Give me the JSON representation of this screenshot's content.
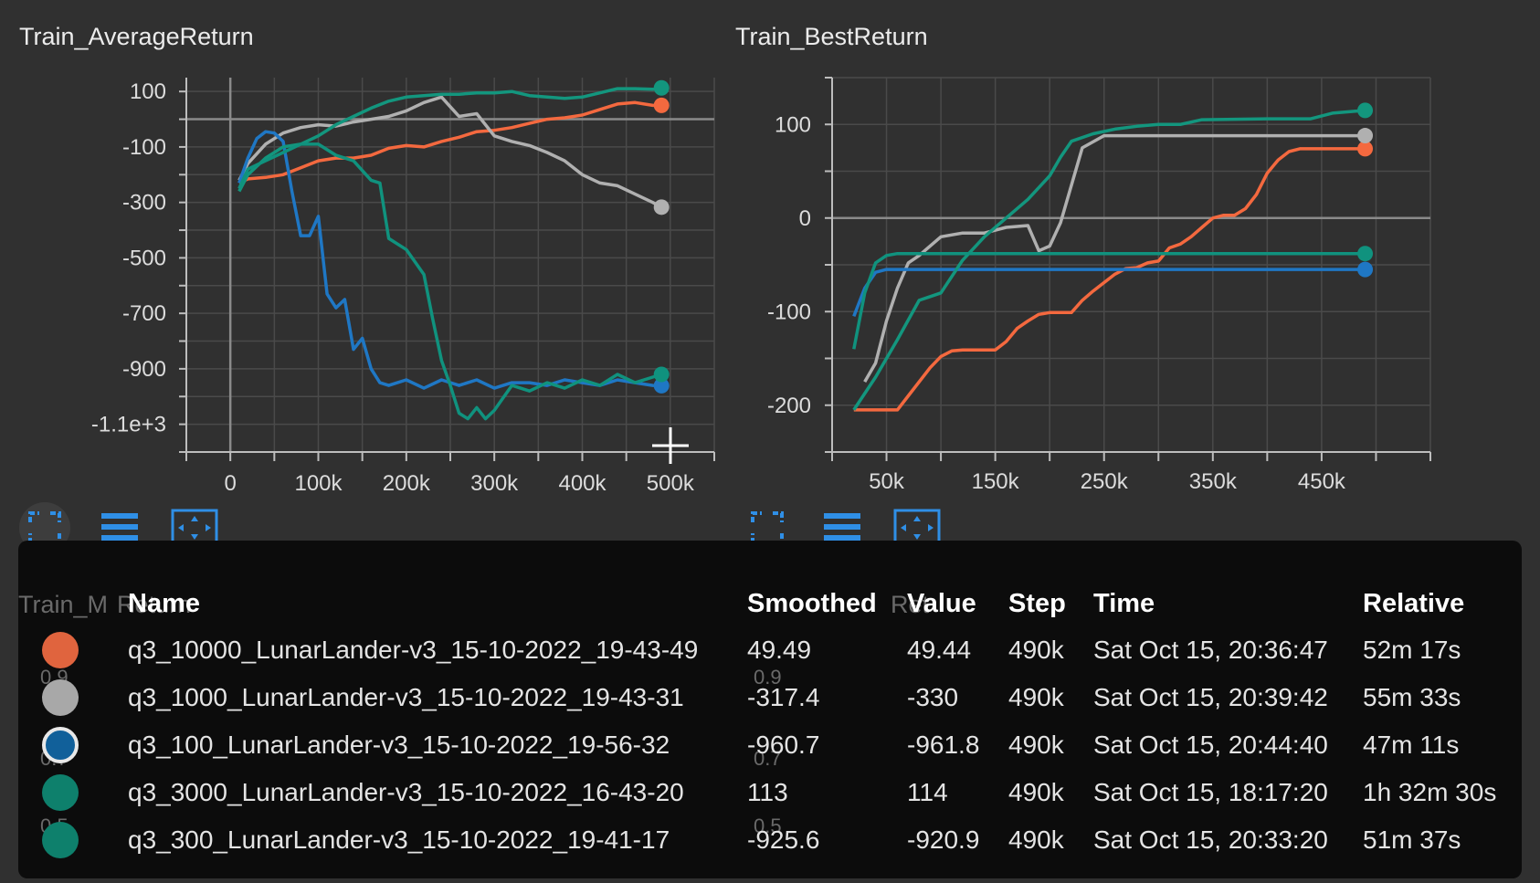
{
  "charts": {
    "left": {
      "title": "Train_AverageReturn"
    },
    "right": {
      "title": "Train_BestReturn"
    },
    "hidden": {
      "title": "Train_MaxReturn",
      "ghost_left": "Train_M",
      "ghost_left_tail": "Return",
      "ghost_right_tail": "Ret"
    }
  },
  "chart_data": [
    {
      "type": "line",
      "title": "Train_AverageReturn",
      "xlabel": "",
      "ylabel": "",
      "xlim": [
        -50000,
        550000
      ],
      "ylim": [
        -1200,
        150
      ],
      "x_ticks": [
        0,
        100000,
        200000,
        300000,
        400000,
        500000
      ],
      "x_tick_labels": [
        "0",
        "100k",
        "200k",
        "300k",
        "400k",
        "500k"
      ],
      "y_ticks": [
        100,
        -100,
        -300,
        -500,
        -700,
        -900,
        -1100
      ],
      "y_tick_labels": [
        "100",
        "-100",
        "-300",
        "-500",
        "-700",
        "-900",
        "-1.1e+3"
      ],
      "grid": true,
      "series": [
        {
          "color": "#f4693f",
          "x": [
            10000,
            20000,
            40000,
            60000,
            80000,
            100000,
            120000,
            140000,
            160000,
            180000,
            200000,
            220000,
            240000,
            260000,
            280000,
            300000,
            320000,
            340000,
            360000,
            380000,
            400000,
            420000,
            440000,
            460000,
            480000,
            490000
          ],
          "y": [
            -230,
            -215,
            -210,
            -200,
            -175,
            -150,
            -140,
            -140,
            -130,
            -105,
            -95,
            -100,
            -80,
            -65,
            -45,
            -40,
            -30,
            -15,
            0,
            5,
            15,
            35,
            55,
            60,
            50,
            50
          ]
        },
        {
          "color": "#b0b0b0",
          "x": [
            10000,
            20000,
            40000,
            60000,
            80000,
            100000,
            120000,
            140000,
            160000,
            180000,
            200000,
            220000,
            240000,
            250000,
            260000,
            280000,
            300000,
            320000,
            340000,
            360000,
            380000,
            400000,
            420000,
            440000,
            460000,
            480000,
            490000
          ],
          "y": [
            -220,
            -160,
            -90,
            -50,
            -30,
            -20,
            -25,
            -10,
            0,
            10,
            30,
            60,
            80,
            45,
            10,
            20,
            -60,
            -80,
            -95,
            -120,
            -150,
            -200,
            -230,
            -240,
            -270,
            -300,
            -317
          ]
        },
        {
          "color": "#1f77c4",
          "x": [
            10000,
            20000,
            30000,
            40000,
            50000,
            60000,
            70000,
            80000,
            90000,
            100000,
            110000,
            120000,
            130000,
            140000,
            150000,
            160000,
            170000,
            180000,
            200000,
            220000,
            240000,
            260000,
            280000,
            300000,
            320000,
            340000,
            360000,
            380000,
            400000,
            420000,
            440000,
            460000,
            480000,
            490000
          ],
          "y": [
            -230,
            -140,
            -70,
            -45,
            -50,
            -80,
            -260,
            -420,
            -420,
            -350,
            -630,
            -680,
            -650,
            -830,
            -790,
            -900,
            -950,
            -960,
            -940,
            -970,
            -940,
            -960,
            -940,
            -970,
            -950,
            -950,
            -960,
            -940,
            -950,
            -960,
            -940,
            -950,
            -960,
            -961
          ]
        },
        {
          "color": "#13967e",
          "x": [
            10000,
            20000,
            40000,
            60000,
            80000,
            100000,
            120000,
            140000,
            160000,
            180000,
            200000,
            220000,
            240000,
            260000,
            280000,
            300000,
            320000,
            340000,
            360000,
            380000,
            400000,
            420000,
            440000,
            460000,
            480000,
            490000
          ],
          "y": [
            -260,
            -200,
            -140,
            -100,
            -90,
            -60,
            -20,
            10,
            40,
            65,
            80,
            85,
            90,
            90,
            95,
            95,
            100,
            85,
            80,
            75,
            80,
            95,
            110,
            110,
            108,
            113
          ]
        },
        {
          "color": "#10927e",
          "x": [
            10000,
            20000,
            40000,
            60000,
            80000,
            100000,
            120000,
            140000,
            160000,
            170000,
            180000,
            200000,
            220000,
            230000,
            240000,
            250000,
            260000,
            270000,
            280000,
            290000,
            300000,
            320000,
            340000,
            360000,
            380000,
            400000,
            420000,
            440000,
            460000,
            480000,
            490000
          ],
          "y": [
            -250,
            -180,
            -150,
            -120,
            -90,
            -90,
            -130,
            -150,
            -220,
            -230,
            -430,
            -470,
            -560,
            -720,
            -870,
            -960,
            -1060,
            -1080,
            -1040,
            -1080,
            -1050,
            -960,
            -980,
            -950,
            -970,
            -940,
            -960,
            -920,
            -950,
            -930,
            -920
          ]
        }
      ]
    },
    {
      "type": "line",
      "title": "Train_BestReturn",
      "xlabel": "",
      "ylabel": "",
      "xlim": [
        0,
        550000
      ],
      "ylim": [
        -250,
        150
      ],
      "x_ticks": [
        50000,
        150000,
        250000,
        350000,
        450000
      ],
      "x_tick_labels": [
        "50k",
        "150k",
        "250k",
        "350k",
        "450k"
      ],
      "y_ticks": [
        100,
        0,
        -100,
        -200
      ],
      "y_tick_labels": [
        "100",
        "0",
        "-100",
        "-200"
      ],
      "grid": true,
      "series": [
        {
          "color": "#f4693f",
          "x": [
            20000,
            40000,
            60000,
            70000,
            90000,
            100000,
            110000,
            120000,
            130000,
            140000,
            150000,
            160000,
            170000,
            180000,
            190000,
            200000,
            220000,
            230000,
            240000,
            260000,
            270000,
            280000,
            290000,
            300000,
            310000,
            320000,
            330000,
            340000,
            350000,
            360000,
            370000,
            380000,
            390000,
            400000,
            410000,
            420000,
            430000,
            440000,
            460000,
            490000
          ],
          "y": [
            -205,
            -205,
            -205,
            -190,
            -160,
            -148,
            -142,
            -141,
            -141,
            -141,
            -141,
            -132,
            -118,
            -110,
            -103,
            -101,
            -101,
            -88,
            -78,
            -60,
            -54,
            -53,
            -48,
            -46,
            -32,
            -28,
            -20,
            -10,
            0,
            3,
            3,
            10,
            25,
            48,
            62,
            71,
            74,
            74,
            74,
            74
          ]
        },
        {
          "color": "#b0b0b0",
          "x": [
            30000,
            40000,
            50000,
            60000,
            70000,
            80000,
            100000,
            120000,
            140000,
            160000,
            180000,
            190000,
            200000,
            210000,
            220000,
            230000,
            250000,
            300000,
            400000,
            490000
          ],
          "y": [
            -175,
            -155,
            -110,
            -75,
            -48,
            -40,
            -20,
            -16,
            -16,
            -10,
            -8,
            -35,
            -30,
            -5,
            35,
            75,
            88,
            88,
            88,
            88
          ]
        },
        {
          "color": "#1f77c4",
          "x": [
            20000,
            30000,
            40000,
            50000,
            60000,
            100000,
            200000,
            300000,
            400000,
            490000
          ],
          "y": [
            -105,
            -75,
            -58,
            -55,
            -55,
            -55,
            -55,
            -55,
            -55,
            -55
          ]
        },
        {
          "color": "#13967e",
          "x": [
            20000,
            40000,
            60000,
            80000,
            100000,
            120000,
            140000,
            160000,
            180000,
            200000,
            210000,
            220000,
            240000,
            260000,
            280000,
            300000,
            320000,
            340000,
            400000,
            440000,
            460000,
            490000
          ],
          "y": [
            -205,
            -170,
            -130,
            -88,
            -80,
            -45,
            -20,
            0,
            20,
            45,
            65,
            82,
            90,
            95,
            98,
            100,
            100,
            105,
            106,
            106,
            112,
            115
          ]
        },
        {
          "color": "#10927e",
          "x": [
            20000,
            30000,
            40000,
            50000,
            60000,
            100000,
            200000,
            300000,
            400000,
            490000
          ],
          "y": [
            -140,
            -80,
            -48,
            -40,
            -38,
            -38,
            -38,
            -38,
            -38,
            -38
          ]
        }
      ]
    }
  ],
  "tooltip": {
    "headers": {
      "name": "Name",
      "smoothed": "Smoothed",
      "value": "Value",
      "step": "Step",
      "time": "Time",
      "relative": "Relative"
    },
    "rows": [
      {
        "color": "#e0643e",
        "name": "q3_10000_LunarLander-v3_15-10-2022_19-43-49",
        "smoothed": "49.49",
        "value": "49.44",
        "step": "490k",
        "time": "Sat Oct 15, 20:36:47",
        "relative": "52m 17s"
      },
      {
        "color": "#a8a8a8",
        "name": "q3_1000_LunarLander-v3_15-10-2022_19-43-31",
        "smoothed": "-317.4",
        "value": "-330",
        "step": "490k",
        "time": "Sat Oct 15, 20:39:42",
        "relative": "55m 33s"
      },
      {
        "color": "#11609a",
        "name": "q3_100_LunarLander-v3_15-10-2022_19-56-32",
        "smoothed": "-960.7",
        "value": "-961.8",
        "step": "490k",
        "time": "Sat Oct 15, 20:44:40",
        "relative": "47m 11s"
      },
      {
        "color": "#0e806c",
        "name": "q3_3000_LunarLander-v3_15-10-2022_16-43-20",
        "smoothed": "113",
        "value": "114",
        "step": "490k",
        "time": "Sat Oct 15, 18:17:20",
        "relative": "1h 32m 30s"
      },
      {
        "color": "#0e806c",
        "name": "q3_300_LunarLander-v3_15-10-2022_19-41-17",
        "smoothed": "-925.6",
        "value": "-920.9",
        "step": "490k",
        "time": "Sat Oct 15, 20:33:20",
        "relative": "51m 37s"
      }
    ]
  },
  "ghost_ticks": {
    "a": "0.9",
    "b": "0.9",
    "c": "0.7",
    "d": "0.7",
    "e": "0.5",
    "f": "0.5"
  },
  "icons": [
    "fullscreen-icon",
    "data-table-icon",
    "fit-domain-icon"
  ]
}
